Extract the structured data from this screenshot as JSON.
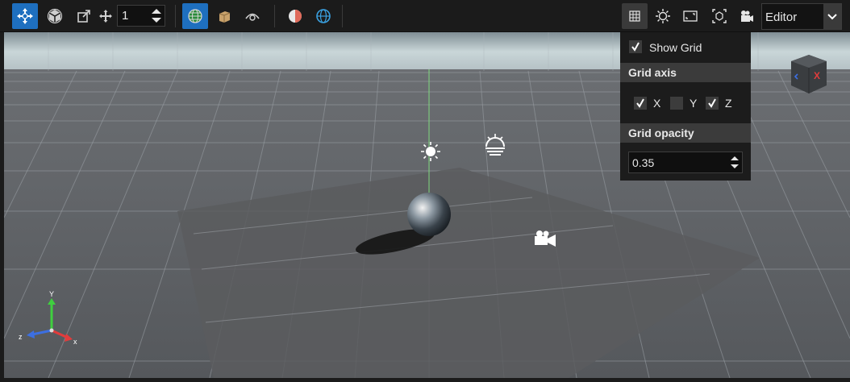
{
  "toolbar": {
    "snap_value": "1",
    "mode_select": "Editor",
    "tools": [
      {
        "name": "move-tool",
        "active": true
      },
      {
        "name": "rotate-tool",
        "active": false
      },
      {
        "name": "scale-tool",
        "active": false
      },
      {
        "name": "snap-translate",
        "active": false
      }
    ],
    "view": [
      {
        "name": "world-space",
        "active": true
      },
      {
        "name": "object-cube",
        "active": false
      },
      {
        "name": "visibility",
        "active": false
      }
    ]
  },
  "grid_popup": {
    "show_grid_label": "Show Grid",
    "show_grid_checked": true,
    "grid_axis_header": "Grid axis",
    "axes": [
      {
        "label": "X",
        "checked": true
      },
      {
        "label": "Y",
        "checked": false
      },
      {
        "label": "Z",
        "checked": true
      }
    ],
    "grid_opacity_header": "Grid opacity",
    "grid_opacity_value": "0.35"
  },
  "gizmo": {
    "x": "x",
    "y": "Y",
    "z": "z"
  },
  "nav_cube": {
    "face_label": "X"
  },
  "colors": {
    "accent": "#1e6fbf",
    "x_axis": "#e23c3c",
    "y_axis": "#3fcf3f",
    "z_axis": "#3c6fe2"
  }
}
